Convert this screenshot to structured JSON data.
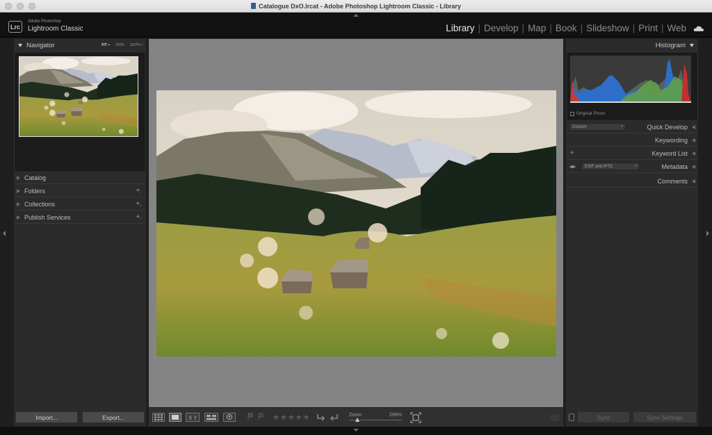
{
  "window": {
    "title": "Catalogue DxO.lrcat - Adobe Photoshop Lightroom Classic - Library"
  },
  "brand": {
    "line1": "Adobe Photoshop",
    "line2": "Lightroom Classic",
    "logo": "Lrc"
  },
  "modules": [
    {
      "label": "Library",
      "active": true
    },
    {
      "label": "Develop",
      "active": false
    },
    {
      "label": "Map",
      "active": false
    },
    {
      "label": "Book",
      "active": false
    },
    {
      "label": "Slideshow",
      "active": false
    },
    {
      "label": "Print",
      "active": false
    },
    {
      "label": "Web",
      "active": false
    }
  ],
  "left_panel": {
    "navigator": {
      "title": "Navigator",
      "zoom_options": [
        "FIT ÷",
        "100%",
        "1197% ÷"
      ]
    },
    "sections": [
      {
        "label": "Catalog",
        "plus": ""
      },
      {
        "label": "Folders",
        "plus": "+."
      },
      {
        "label": "Collections",
        "plus": "+."
      },
      {
        "label": "Publish Services",
        "plus": "+."
      }
    ],
    "import_label": "Import...",
    "export_label": "Export..."
  },
  "right_panel": {
    "histogram_title": "Histogram",
    "original_photo_label": "Original Photo",
    "quick_develop": {
      "label": "Quick Develop",
      "preset": "Custom"
    },
    "keywording_label": "Keywording",
    "keyword_list_label": "Keyword List",
    "metadata": {
      "label": "Metadata",
      "preset": "EXIF and IPTC"
    },
    "comments_label": "Comments",
    "sync_label": "Sync",
    "sync_settings_label": "Sync Settings"
  },
  "toolbar": {
    "zoom_label": "Zoom",
    "zoom_value": "299%",
    "stars": "★★★★★"
  },
  "colors": {
    "panel_bg": "#2b2b2b",
    "center_bg": "#848484",
    "active_module": "#ececec"
  },
  "icons": {
    "cloud": "cloud-icon",
    "grid": "grid-view-icon",
    "loupe": "loupe-view-icon",
    "compare": "compare-view-icon",
    "survey": "survey-view-icon",
    "people": "people-view-icon"
  }
}
